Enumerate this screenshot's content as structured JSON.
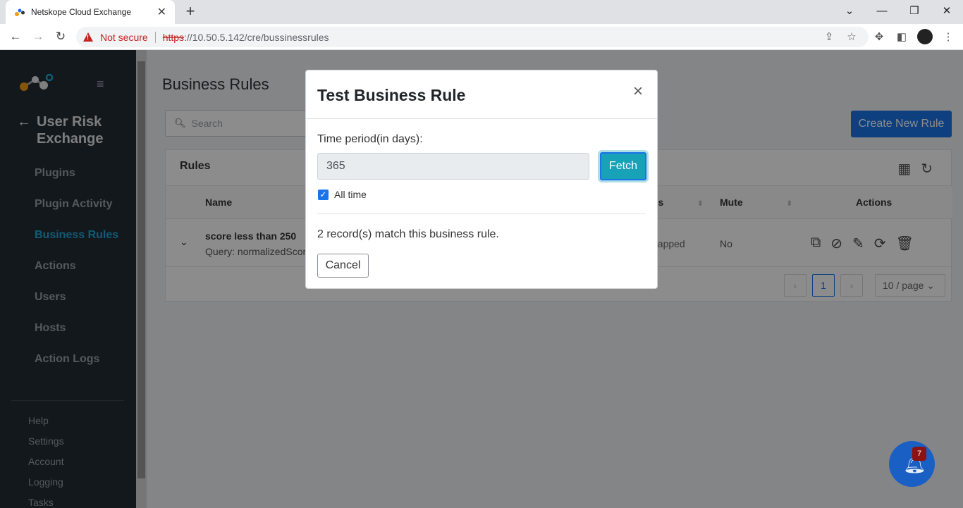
{
  "browser": {
    "tab_title": "Netskope Cloud Exchange",
    "not_secure": "Not secure",
    "url_scheme": "https",
    "url_rest": "://10.50.5.142/cre/bussinessrules"
  },
  "sidebar": {
    "module_title": "User Risk Exchange",
    "nav": [
      {
        "label": "Plugins"
      },
      {
        "label": "Plugin Activity"
      },
      {
        "label": "Business Rules",
        "active": true
      },
      {
        "label": "Actions"
      },
      {
        "label": "Users"
      },
      {
        "label": "Hosts"
      },
      {
        "label": "Action Logs"
      }
    ],
    "footer": [
      "Help",
      "Settings",
      "Account",
      "Logging",
      "Tasks"
    ]
  },
  "main": {
    "page_title": "Business Rules",
    "search_placeholder": "Search",
    "create_button": "Create New Rule",
    "card_title": "Rules",
    "columns": {
      "name": "Name",
      "status_partial": "us",
      "mute": "Mute",
      "actions": "Actions"
    },
    "row": {
      "name": "score less than 250",
      "query": "Query: normalizedScore",
      "status_partial": "napped",
      "mute": "No"
    },
    "pagination": {
      "current_page": "1",
      "per_page": "10 / page"
    }
  },
  "modal": {
    "title": "Test Business Rule",
    "close": "×",
    "time_label": "Time period(in days):",
    "time_value": "365",
    "fetch_button": "Fetch",
    "all_time_label": "All time",
    "all_time_checked": true,
    "result": "2 record(s) match this business rule.",
    "cancel_button": "Cancel"
  },
  "notifications": {
    "count": "7"
  },
  "colors": {
    "accent": "#1a73e8",
    "sidebar_bg": "#232d33",
    "active_nav": "#1ea8d8",
    "fetch": "#17a2b8"
  }
}
